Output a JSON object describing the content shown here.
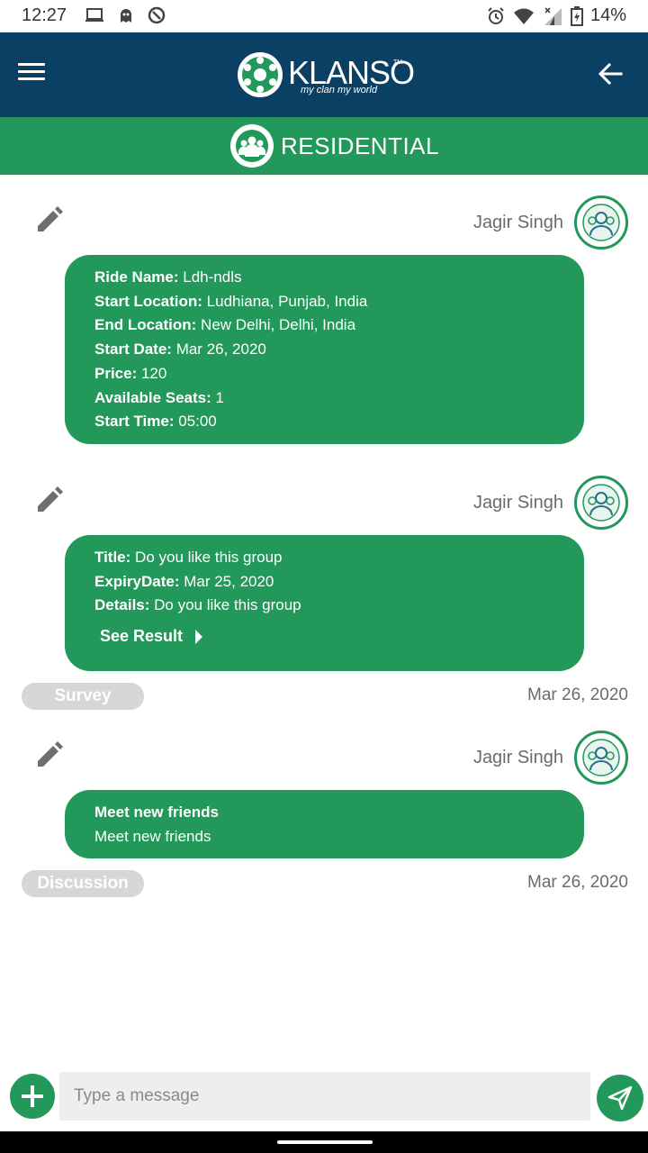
{
  "status_bar": {
    "time": "12:27",
    "battery": "14%",
    "icons": [
      "laptop-icon",
      "ghost-icon",
      "vpn-icon",
      "alarm-icon",
      "wifi-icon",
      "signal-icon",
      "battery-icon"
    ]
  },
  "app_bar": {
    "brand": "KLANSO",
    "trademark": "TM",
    "tagline": "my clan my world",
    "menu_icon": "hamburger-menu-icon",
    "back_icon": "back-arrow-icon"
  },
  "category": {
    "label": "RESIDENTIAL",
    "icon": "group-icon"
  },
  "posts": [
    {
      "author": "Jagir Singh",
      "fields": [
        {
          "label": "Ride Name:",
          "value": " Ldh-ndls"
        },
        {
          "label": "Start Location:",
          "value": " Ludhiana, Punjab, India"
        },
        {
          "label": "End Location:",
          "value": " New Delhi, Delhi, India"
        },
        {
          "label": "Start Date:",
          "value": " Mar 26, 2020"
        },
        {
          "label": "Price:",
          "value": " 120"
        },
        {
          "label": "Available Seats:",
          "value": " 1"
        },
        {
          "label": "Start Time:",
          "value": " 05:00"
        }
      ]
    },
    {
      "author": "Jagir Singh",
      "fields": [
        {
          "label": "Title:",
          "value": " Do you like this group"
        },
        {
          "label": "ExpiryDate:",
          "value": " Mar 25, 2020"
        },
        {
          "label": "Details:",
          "value": " Do you like this group"
        }
      ],
      "action": "See Result",
      "tag": "Survey",
      "date": "Mar 26, 2020"
    },
    {
      "author": "Jagir Singh",
      "heading": "Meet new friends",
      "body": "Meet new friends",
      "tag": "Discussion",
      "date": "Mar 26, 2020"
    }
  ],
  "composer": {
    "placeholder": "Type a message"
  },
  "colors": {
    "app_bar": "#0a4064",
    "accent_green": "#22985a",
    "chip_gray": "#d6d6d6"
  }
}
